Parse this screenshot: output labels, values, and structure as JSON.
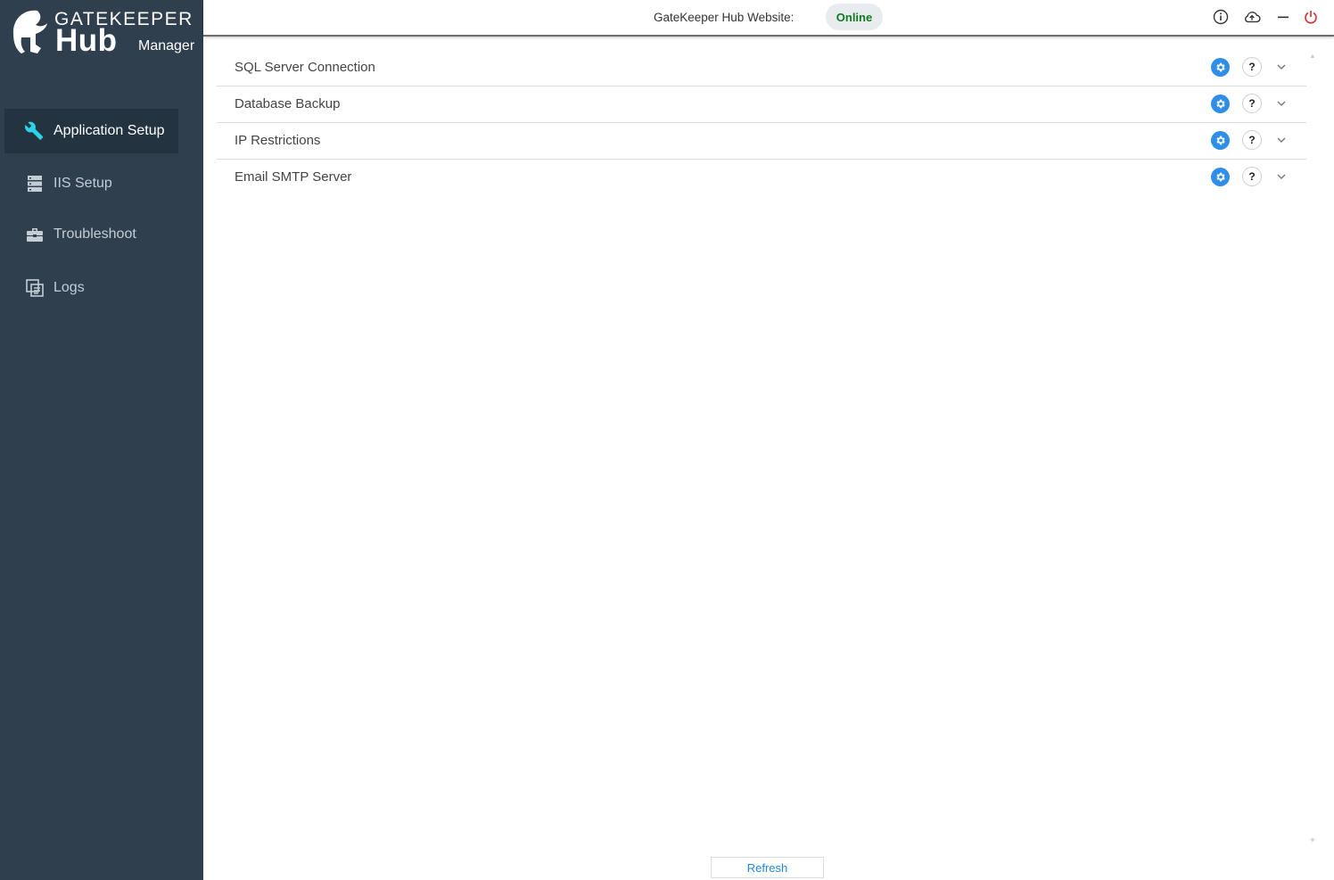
{
  "brand": {
    "line1": "GATEKEEPER",
    "line2": "Hub",
    "line3": "Manager"
  },
  "sidebar": {
    "items": [
      {
        "label": "Application Setup",
        "icon": "wrench-icon",
        "active": true
      },
      {
        "label": "IIS Setup",
        "icon": "server-icon",
        "active": false
      },
      {
        "label": "Troubleshoot",
        "icon": "toolbox-icon",
        "active": false
      },
      {
        "label": "Logs",
        "icon": "logs-icon",
        "active": false
      }
    ]
  },
  "topbar": {
    "site_label": "GateKeeper Hub Website:",
    "status": "Online",
    "status_color": "#0f7a1e",
    "icons": [
      "info-icon",
      "cloud-upload-icon",
      "minimize-icon",
      "power-icon"
    ]
  },
  "sections": [
    {
      "label": "SQL Server Connection"
    },
    {
      "label": "Database Backup"
    },
    {
      "label": "IP Restrictions"
    },
    {
      "label": "Email SMTP Server"
    }
  ],
  "footer": {
    "refresh_label": "Refresh"
  },
  "colors": {
    "sidebar_bg": "#2f3f4e",
    "accent": "#2e8ee8",
    "active_icon": "#2ad4e6",
    "power": "#d32f2f"
  }
}
